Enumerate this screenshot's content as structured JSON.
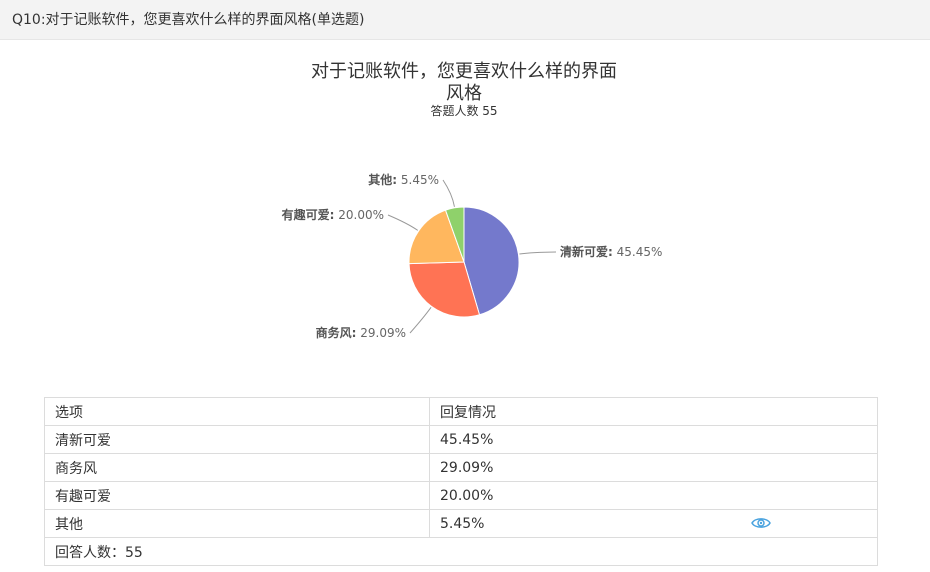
{
  "question": {
    "title": "Q10:对于记账软件，您更喜欢什么样的界面风格(单选题)"
  },
  "chart_data": {
    "type": "pie",
    "title_line1": "对于记账软件，您更喜欢什么样的界面",
    "title_line2": "风格",
    "subtitle": "答题人数 55",
    "slices": [
      {
        "name": "清新可爱",
        "value": 45.45,
        "label": "45.45%",
        "color": "#7479cc"
      },
      {
        "name": "商务风",
        "value": 29.09,
        "label": "29.09%",
        "color": "#ff7354"
      },
      {
        "name": "有趣可爱",
        "value": 20.0,
        "label": "20.00%",
        "color": "#ffb75e"
      },
      {
        "name": "其他",
        "value": 5.45,
        "label": "5.45%",
        "color": "#8fd16b"
      }
    ]
  },
  "table": {
    "headers": [
      "选项",
      "回复情况"
    ],
    "rows": [
      {
        "option": "清新可爱",
        "value": "45.45%"
      },
      {
        "option": "商务风",
        "value": "29.09%"
      },
      {
        "option": "有趣可爱",
        "value": "20.00%"
      },
      {
        "option": "其他",
        "value": "5.45%"
      }
    ],
    "footer": "回答人数：55"
  },
  "icons": {
    "detail": "eye-icon"
  }
}
